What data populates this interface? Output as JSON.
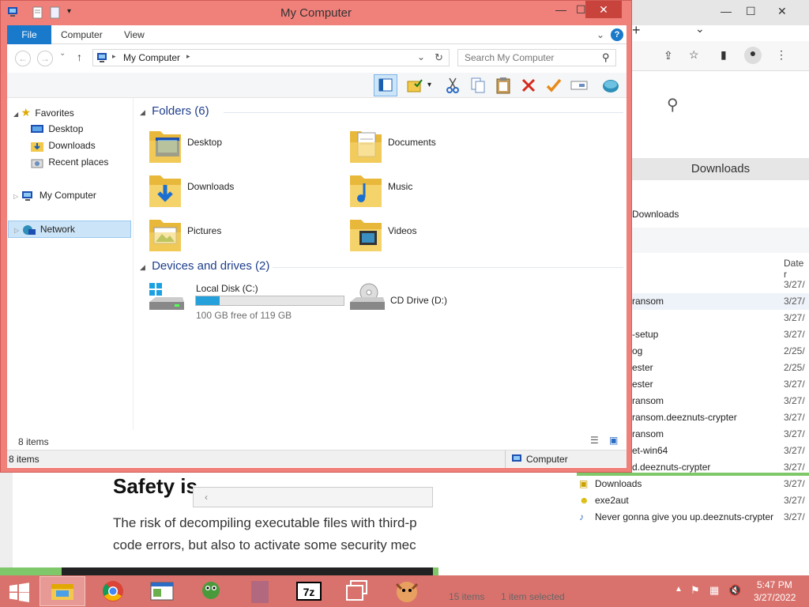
{
  "explorer": {
    "title": "My Computer",
    "ribbon_tabs": {
      "file": "File",
      "computer": "Computer",
      "view": "View"
    },
    "address_path": "My Computer",
    "search_placeholder": "Search My Computer",
    "nav": {
      "favorites": "Favorites",
      "desktop": "Desktop",
      "downloads": "Downloads",
      "recent": "Recent places",
      "my_computer": "My Computer",
      "network": "Network"
    },
    "folders_header": "Folders (6)",
    "folders": [
      "Desktop",
      "Documents",
      "Downloads",
      "Music",
      "Pictures",
      "Videos"
    ],
    "drives_header": "Devices and drives (2)",
    "local_disk": {
      "name": "Local Disk (C:)",
      "free_text": "100 GB free of 119 GB",
      "used_fraction": 0.16
    },
    "cd_drive": "CD Drive (D:)",
    "items_count_inner": "8 items",
    "status_left": "8 items",
    "status_right": "Computer"
  },
  "background_window": {
    "title": "Downloads",
    "path": "Downloads",
    "column_date": "Date r",
    "rows": [
      {
        "name": "",
        "date": "3/27/"
      },
      {
        "name": "ransom",
        "date": "3/27/"
      },
      {
        "name": "",
        "date": "3/27/"
      },
      {
        "name": "-setup",
        "date": "3/27/"
      },
      {
        "name": "og",
        "date": "2/25/"
      },
      {
        "name": "ester",
        "date": "2/25/"
      },
      {
        "name": "ester",
        "date": "3/27/"
      },
      {
        "name": "ransom",
        "date": "3/27/"
      },
      {
        "name": "ransom.deeznuts-crypter",
        "date": "3/27/"
      },
      {
        "name": "ransom",
        "date": "3/27/"
      },
      {
        "name": "et-win64",
        "date": "3/27/"
      },
      {
        "name": "d.deeznuts-crypter",
        "date": "3/27/"
      }
    ],
    "full_rows": [
      {
        "name": "Downloads",
        "date": "3/27/"
      },
      {
        "name": "exe2aut",
        "date": "3/27/"
      },
      {
        "name": "Never gonna give you up.deeznuts-crypter",
        "date": "3/27/"
      }
    ],
    "footer_count": "15 items",
    "footer_selected": "1 item selected"
  },
  "article": {
    "heading": "Safety is",
    "line1": "The risk of decompiling executable files with third-p",
    "line2": "code errors, but also to activate some security mec"
  },
  "taskbar": {
    "time": "5:47 PM",
    "date": "3/27/2022"
  },
  "colors": {
    "accent": "#1979ca",
    "window_frame": "#f0807a",
    "taskbar": "#d9726d",
    "disk_bar": "#26a0da"
  }
}
